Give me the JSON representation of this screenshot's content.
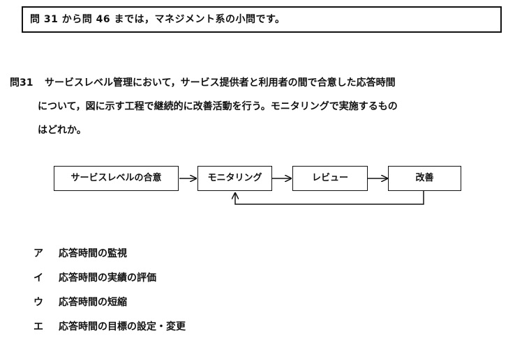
{
  "notice": "問 31 から問 46 までは，マネジメント系の小問です。",
  "question": {
    "number": "問31",
    "text_line1": "サービスレベル管理において，サービス提供者と利用者の間で合意した応答時間",
    "text_line2": "について，図に示す工程で継続的に改善活動を行う。モニタリングで実施するもの",
    "text_line3": "はどれか。"
  },
  "diagram": {
    "steps": [
      "サービスレベルの合意",
      "モニタリング",
      "レビュー",
      "改善"
    ]
  },
  "choices": [
    {
      "mark": "ア",
      "text": "応答時間の監視"
    },
    {
      "mark": "イ",
      "text": "応答時間の実績の評価"
    },
    {
      "mark": "ウ",
      "text": "応答時間の短縮"
    },
    {
      "mark": "エ",
      "text": "応答時間の目標の設定・変更"
    }
  ]
}
